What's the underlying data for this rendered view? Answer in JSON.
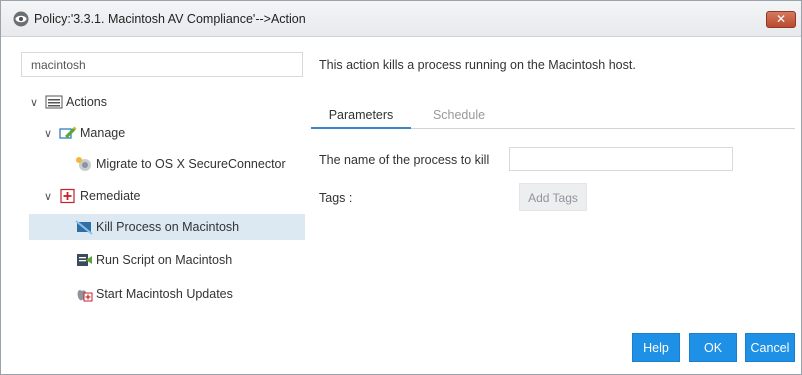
{
  "window": {
    "title": "Policy:'3.3.1. Macintosh AV Compliance'-->Action",
    "close_label": "✕"
  },
  "search": {
    "value": "macintosh"
  },
  "tree": {
    "root": {
      "label": "Actions",
      "icon": "list-icon"
    },
    "groups": [
      {
        "label": "Manage",
        "icon": "manage-icon",
        "items": [
          {
            "label": "Migrate to OS X SecureConnector",
            "icon": "migrate-icon"
          }
        ]
      },
      {
        "label": "Remediate",
        "icon": "remediate-plus-icon",
        "items": [
          {
            "label": "Kill Process on Macintosh",
            "icon": "kill-process-icon",
            "selected": true
          },
          {
            "label": "Run Script on Macintosh",
            "icon": "run-script-icon"
          },
          {
            "label": "Start Macintosh Updates",
            "icon": "updates-icon"
          }
        ]
      }
    ]
  },
  "description": "This action kills a process running on the Macintosh host.",
  "tabs": [
    {
      "label": "Parameters",
      "active": true
    },
    {
      "label": "Schedule",
      "active": false
    }
  ],
  "form": {
    "process_label": "The name of the process to kill",
    "process_value": "",
    "tags_label": "Tags :",
    "add_tags_label": "Add Tags"
  },
  "buttons": {
    "help": "Help",
    "ok": "OK",
    "cancel": "Cancel"
  },
  "colors": {
    "accent": "#1e90e6",
    "selected_row": "#dde9f2",
    "tab_underline": "#3a86c8",
    "close_button": "#c55a3e"
  }
}
